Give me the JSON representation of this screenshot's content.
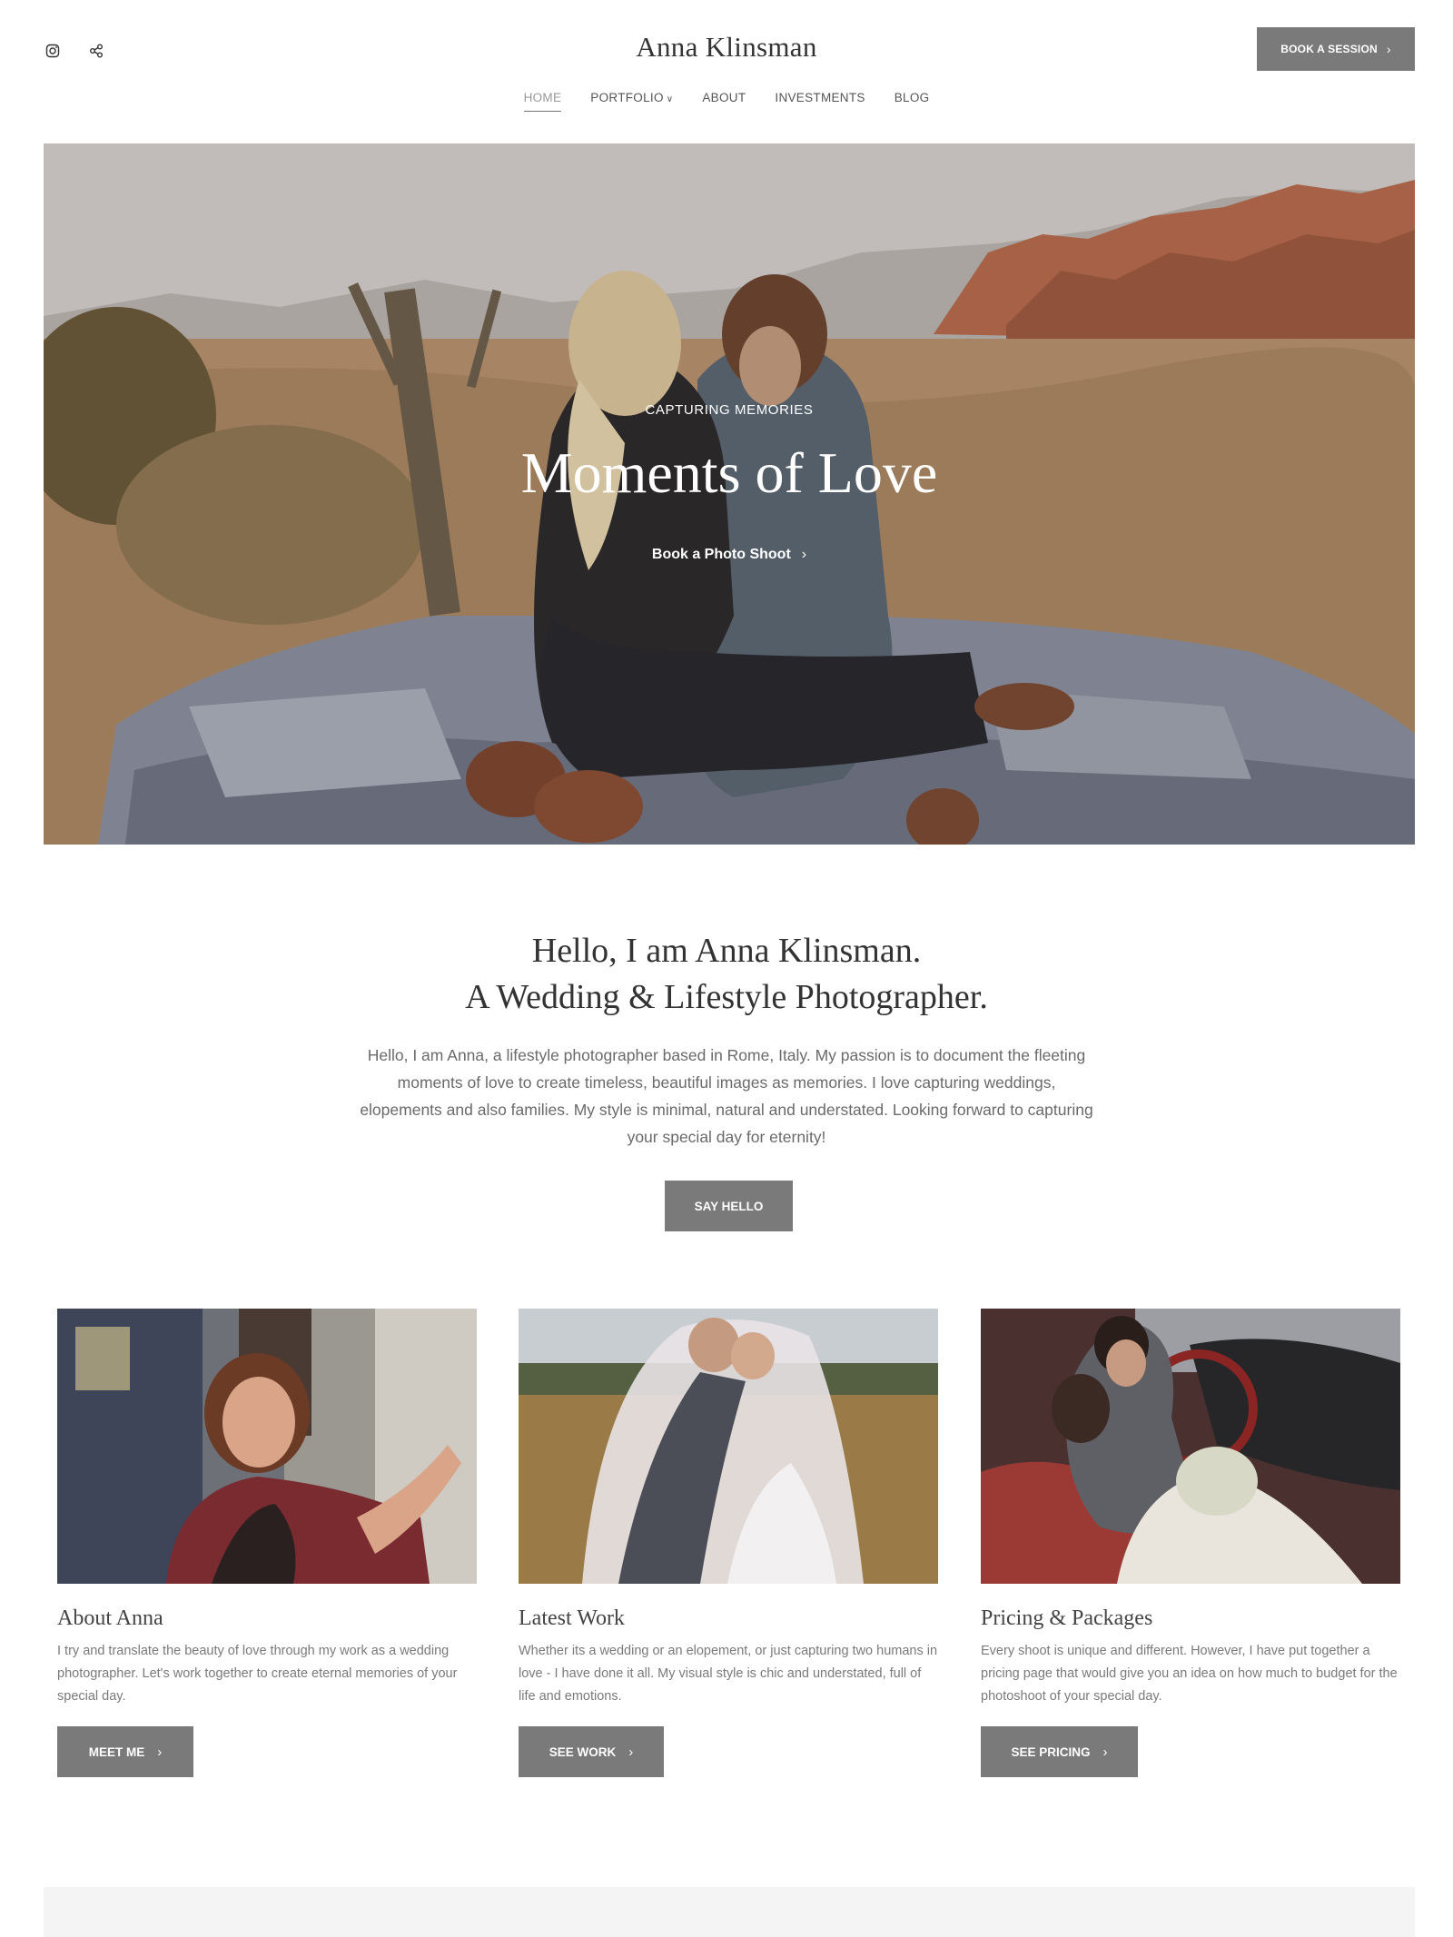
{
  "header": {
    "brand": "Anna Klinsman",
    "book_label": "BOOK A SESSION",
    "social_icons": [
      "instagram-icon",
      "share-icon"
    ],
    "nav": [
      {
        "label": "HOME",
        "active": true
      },
      {
        "label": "PORTFOLIO",
        "dropdown": true
      },
      {
        "label": "ABOUT"
      },
      {
        "label": "INVESTMENTS"
      },
      {
        "label": "BLOG"
      }
    ]
  },
  "hero": {
    "kicker": "CAPTURING MEMORIES",
    "title": "Moments of Love",
    "cta": "Book a Photo Shoot"
  },
  "intro": {
    "title_line1": "Hello, I am Anna Klinsman.",
    "title_line2": "A Wedding & Lifestyle Photographer.",
    "body": "Hello, I am Anna, a lifestyle photographer based in Rome, Italy. My passion is to document the fleeting moments of love to create timeless, beautiful images as memories. I love capturing weddings, elopements and also families. My style is minimal, natural and understated. Looking forward to capturing your special day for eternity!",
    "button": "SAY HELLO"
  },
  "cards": [
    {
      "title": "About Anna",
      "text": "I try and translate the beauty of love through my work as a wedding photographer. Let's work together to create eternal memories of your special day.",
      "button": "MEET ME"
    },
    {
      "title": "Latest Work",
      "text": "Whether its a wedding or an elopement, or just capturing two humans in love - I have done it all. My visual style is chic and understated, full of life and emotions.",
      "button": "SEE WORK"
    },
    {
      "title": "Pricing & Packages",
      "text": "Every shoot is unique and different. However, I have put together a pricing page that would give you an idea on how much to budget for the photoshoot of your special day.",
      "button": "SEE PRICING"
    }
  ],
  "colors": {
    "button_bg": "#7a7a7a",
    "text_dark": "#333333",
    "text_body": "#6a6a6a"
  }
}
